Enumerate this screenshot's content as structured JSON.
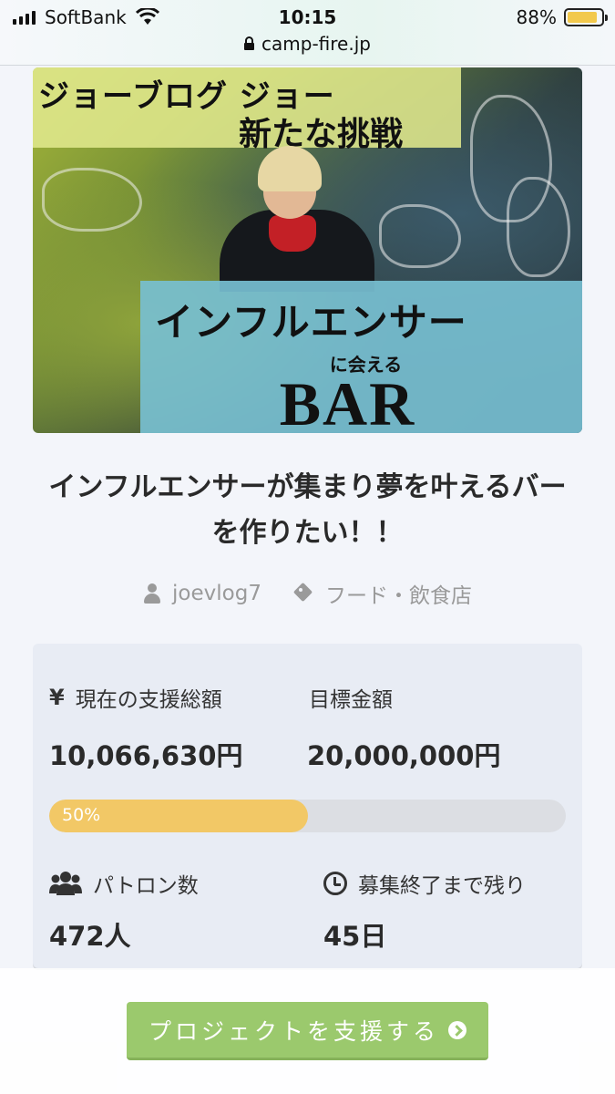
{
  "status_bar": {
    "carrier": "SoftBank",
    "time": "10:15",
    "battery_percent": "88%",
    "battery_level": 0.88,
    "url": "camp-fire.jp"
  },
  "hero": {
    "line1": "ジョーブログ ジョー",
    "line2": "新たな挑戦",
    "line3": "インフルエンサー",
    "line4": "に会える",
    "line5": "BAR"
  },
  "project": {
    "title": "インフルエンサーが集まり夢を叶えるバーを作りたい！！",
    "author": "joevlog7",
    "category": "フード・飲食店"
  },
  "stats": {
    "current_label": "現在の支援総額",
    "current_value": "10,066,630円",
    "goal_label": "目標金額",
    "goal_value": "20,000,000円",
    "progress_text": "50%",
    "progress_fraction": 0.5,
    "patrons_label": "パトロン数",
    "patrons_value": "472人",
    "remaining_label": "募集終了まで残り",
    "remaining_value": "45日",
    "yen_symbol": "¥"
  },
  "bottom": {
    "support_button": "プロジェクトを支援する"
  },
  "colors": {
    "accent_green": "#9bc96d",
    "progress_yellow": "#f2c866",
    "card_bg": "#e8ecf4"
  }
}
